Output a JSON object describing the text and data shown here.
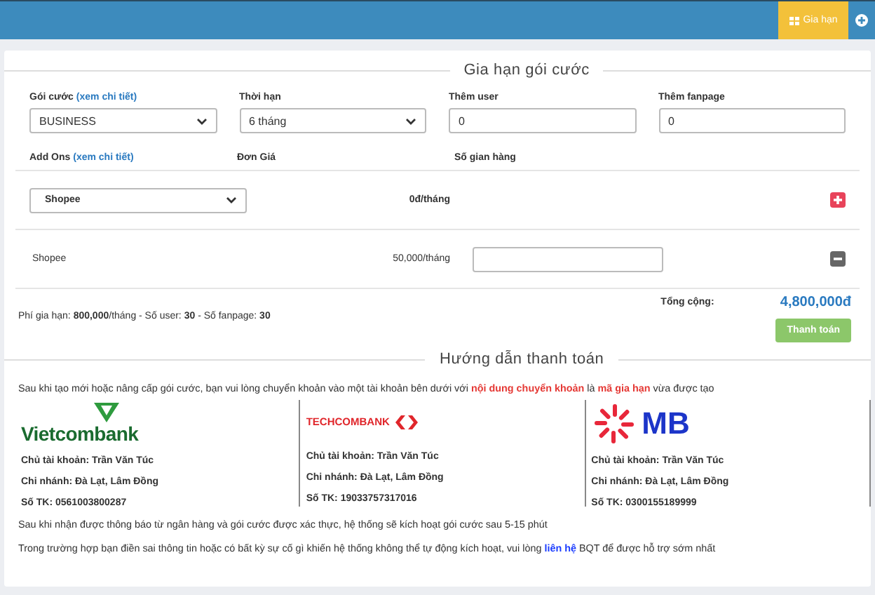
{
  "topbar": {
    "renew_button": "Gia hạn"
  },
  "form": {
    "title": "Gia hạn gói cước",
    "fields": [
      {
        "label": "Gói cước",
        "link": "(xem chi tiết)",
        "kind": "select",
        "value": "BUSINESS"
      },
      {
        "label": "Thời hạn",
        "kind": "select",
        "value": "6 tháng"
      },
      {
        "label": "Thêm user",
        "kind": "input",
        "value": "0"
      },
      {
        "label": "Thêm fanpage",
        "kind": "input",
        "value": "0"
      }
    ],
    "addons_header": {
      "label": "Add Ons",
      "link": "(xem chi tiết)",
      "price_column": "Đơn Giá",
      "stores_column": "Số gian hàng"
    },
    "addons": [
      {
        "kind": "select",
        "name": "Shopee",
        "price": "0đ/tháng"
      },
      {
        "kind": "item",
        "name": "Shopee",
        "price": "50,000/tháng"
      }
    ],
    "summary": "Phí gia hạn: **800,000**/tháng - Số user: **30** - Số fanpage: **30**",
    "total_label": "Tổng cộng:",
    "total": "4,800,000đ",
    "pay_button": "Thanh toán"
  },
  "payment": {
    "title": "Hướng dẫn thanh toán",
    "intro": [
      {
        "text": "Sau khi tạo mới hoặc nâng cấp gói cước, bạn vui lòng chuyển khoản vào một tài khoản bên dưới với ",
        "highlight": false
      },
      {
        "text": "nội dung chuyển khoản",
        "highlight": true
      },
      {
        "text": " là ",
        "highlight": false
      },
      {
        "text": "mã gia hạn",
        "highlight": true
      },
      {
        "text": " vừa được tạo",
        "highlight": false
      }
    ],
    "banks": [
      {
        "kind": "vietcombank",
        "logo": "Vietcombank",
        "holder": "Chủ tài khoản: Trần Văn Túc",
        "branch": "Chi nhánh: Đà Lạt, Lâm Đồng",
        "account": "Số TK: 0561003800287"
      },
      {
        "kind": "techcombank",
        "logo": "TECHCOMBANK",
        "holder": "Chủ tài khoản: Trần Văn Túc",
        "branch": "Chi nhánh: Đà Lạt, Lâm Đồng",
        "account": "Số TK: 19033757317016"
      },
      {
        "kind": "mb",
        "logo": "MB",
        "holder": "Chủ tài khoản: Trần Văn Túc",
        "branch": "Chi nhánh: Đà Lạt, Lâm Đồng",
        "account": "Số TK: 0300155189999"
      }
    ],
    "note": "Sau khi nhận được thông báo từ ngân hàng và gói cước được xác thực, hệ thống sẽ kích hoạt gói cước sau 5-15 phút",
    "support": [
      {
        "text": "Trong trường hợp bạn điền sai thông tin hoặc có bất kỳ sự cố gì khiến hệ thống không thể tự động kích hoạt, vui lòng ",
        "link": false
      },
      {
        "text": "liên hệ",
        "link": true
      },
      {
        "text": " BQT để được hỗ trợ sớm nhất",
        "link": false
      }
    ]
  }
}
